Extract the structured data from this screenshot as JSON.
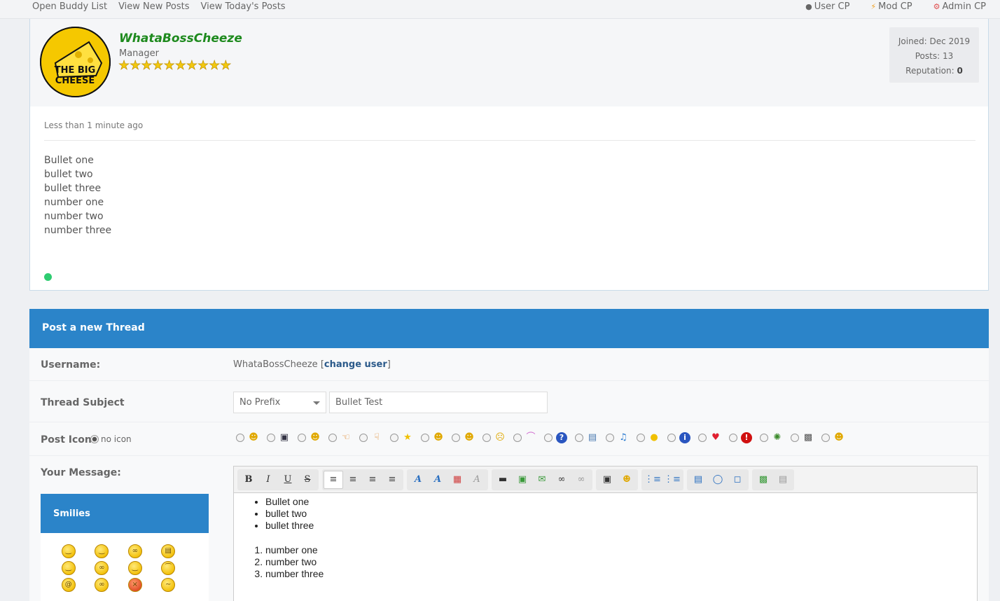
{
  "topbar": {
    "left_links": [
      "Open Buddy List",
      "View New Posts",
      "View Today's Posts"
    ],
    "user_cp": "User CP",
    "mod_cp": "Mod CP",
    "admin_cp": "Admin CP"
  },
  "post": {
    "author": "WhataBossCheeze",
    "author_title": "Manager",
    "star_count": 10,
    "avatar_text_line1": "THE BIG",
    "avatar_text_line2": "CHEESE",
    "joined": "Joined: Dec 2019",
    "posts": "Posts: 13",
    "reputation_label": "Reputation:",
    "reputation_value": "0",
    "date": "Less than 1 minute ago",
    "body_lines": [
      "Bullet one",
      "bullet two",
      "bullet three",
      "number one",
      "number two",
      "number three"
    ],
    "online_color": "#2ecc71"
  },
  "thread": {
    "header": "Post a new Thread",
    "username_label": "Username:",
    "username_value": "WhataBossCheeze",
    "change_user": "change user",
    "subject_label": "Thread Subject",
    "prefix_value": "No Prefix",
    "subject_value": "Bullet Test",
    "post_icon_label": "Post Icon:",
    "no_icon_label": "no icon",
    "message_label": "Your Message:",
    "smilies_header": "Smilies",
    "editor": {
      "bullets": [
        "Bullet one",
        "bullet two",
        "bullet three"
      ],
      "numbers": [
        "number one",
        "number two",
        "number three"
      ]
    }
  },
  "colors": {
    "accent": "#2b84c9",
    "author": "#1e8a1e"
  }
}
